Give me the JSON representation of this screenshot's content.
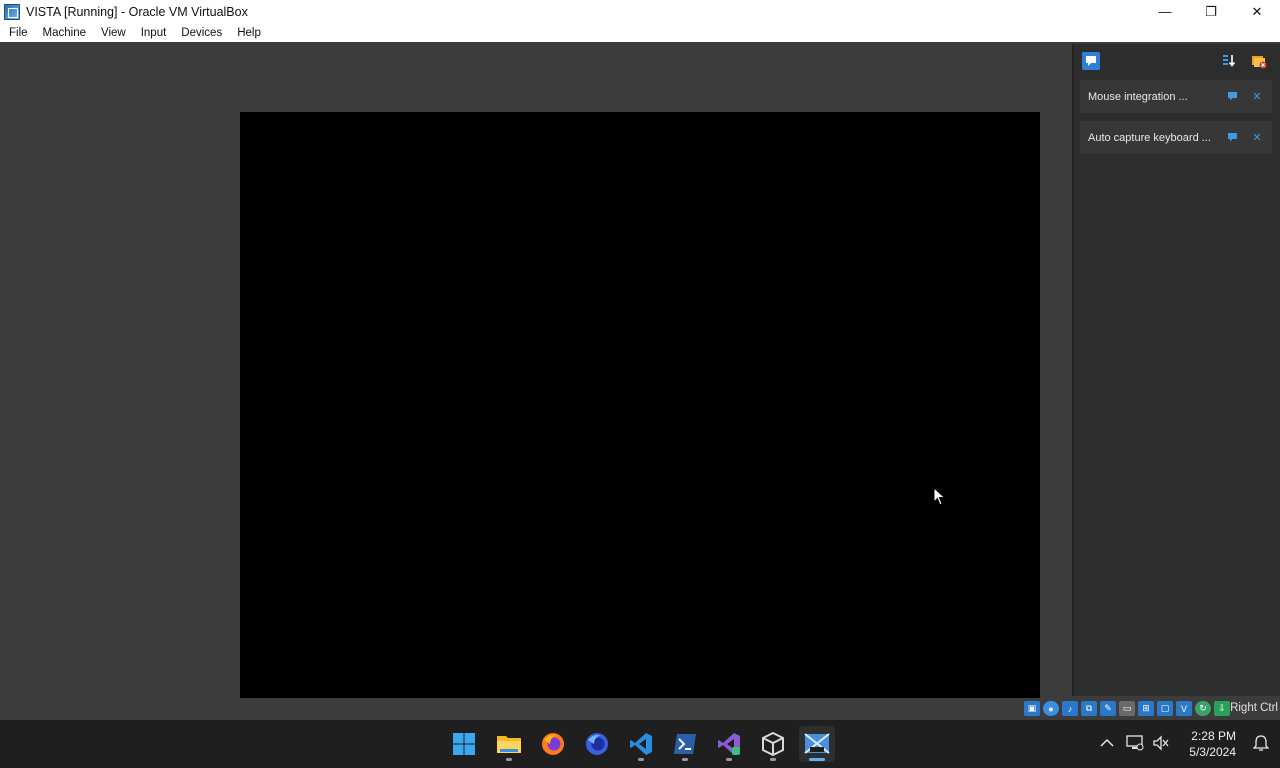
{
  "window": {
    "title": "VISTA [Running] - Oracle VM VirtualBox",
    "minimize_glyph": "—",
    "restore_glyph": "❐",
    "close_glyph": "✕"
  },
  "menu": [
    "File",
    "Machine",
    "View",
    "Input",
    "Devices",
    "Help"
  ],
  "notifications": {
    "items": [
      {
        "text": "Mouse integration ..."
      },
      {
        "text": "Auto capture keyboard ..."
      }
    ],
    "toolbar_icons": [
      "notification-center-icon",
      "sort-icon",
      "clear-all-icon"
    ]
  },
  "statusbar": {
    "icons": [
      "hard-disk-icon",
      "optical-drive-icon",
      "audio-icon",
      "network-icon",
      "usb-icon",
      "shared-folders-icon",
      "display-icon",
      "video-capture-icon",
      "cpu-icon",
      "mouse-integration-icon",
      "keyboard-capture-icon"
    ],
    "host_key": "Right Ctrl"
  },
  "taskbar": {
    "apps": [
      "windows-start-icon",
      "file-explorer-icon",
      "firefox-icon",
      "firefox-dev-icon",
      "vscode-icon",
      "powershell-icon",
      "visual-studio-icon",
      "virtualbox-icon",
      "vista-vm-icon"
    ],
    "active_app": "vista-vm-icon"
  },
  "tray": {
    "time": "2:28 PM",
    "date": "5/3/2024"
  },
  "colors": {
    "vm_background": "#3c3c3c",
    "vm_screen": "#000000",
    "panel": "#2d2d2d",
    "notification": "#373737",
    "accent": "#3f9be6"
  }
}
